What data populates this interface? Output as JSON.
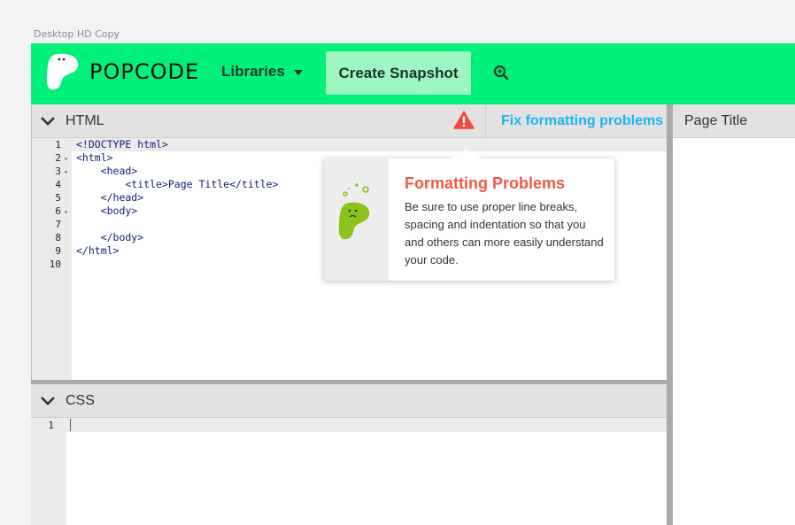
{
  "frame_label": "Desktop HD Copy",
  "topbar": {
    "brand": "POPCODE",
    "libraries_label": "Libraries",
    "snapshot_label": "Create Snapshot",
    "zoom_icon": "zoom-in-icon",
    "accent_color": "#00f07a"
  },
  "html_pane": {
    "title": "HTML",
    "warning_icon": "warning-icon",
    "fix_label": "Fix formatting problems",
    "lines": [
      {
        "n": "1",
        "fold": "",
        "code": "<!DOCTYPE html>"
      },
      {
        "n": "2",
        "fold": "▾",
        "code": "<html>"
      },
      {
        "n": "3",
        "fold": "▾",
        "code": "    <head>"
      },
      {
        "n": "4",
        "fold": "",
        "code": "        <title>Page Title</title>"
      },
      {
        "n": "5",
        "fold": "",
        "code": "    </head>"
      },
      {
        "n": "6",
        "fold": "▾",
        "code": "    <body>"
      },
      {
        "n": "7",
        "fold": "",
        "code": ""
      },
      {
        "n": "8",
        "fold": "",
        "code": "    </body>"
      },
      {
        "n": "9",
        "fold": "",
        "code": "</html>"
      },
      {
        "n": "10",
        "fold": "",
        "code": ""
      }
    ]
  },
  "css_pane": {
    "title": "CSS",
    "lines": [
      {
        "n": "1"
      }
    ]
  },
  "preview_pane": {
    "title": "Page Title"
  },
  "popover": {
    "title": "Formatting Problems",
    "body": "Be sure to use proper line breaks, spacing and indentation so that you and others can more easily understand your code.",
    "title_color": "#ee5a48"
  }
}
